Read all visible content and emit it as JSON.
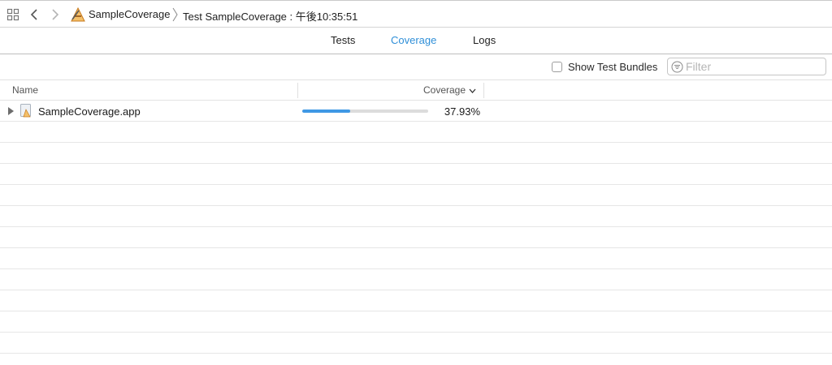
{
  "jumpbar": {
    "breadcrumb_project": "SampleCoverage",
    "breadcrumb_run": "Test SampleCoverage : 午後10:35:51"
  },
  "tabs": [
    {
      "label": "Tests",
      "active": false
    },
    {
      "label": "Coverage",
      "active": true
    },
    {
      "label": "Logs",
      "active": false
    }
  ],
  "filterbar": {
    "show_test_bundles_label": "Show Test Bundles",
    "show_test_bundles_checked": false,
    "filter_placeholder": "Filter"
  },
  "columns": {
    "name": "Name",
    "coverage": "Coverage"
  },
  "rows": [
    {
      "name": "SampleCoverage.app",
      "coverage_text": "37.93%",
      "coverage_fraction": 0.3793
    }
  ],
  "colors": {
    "accent": "#2f8fd8",
    "coverage_bar": "#3f98e5"
  }
}
